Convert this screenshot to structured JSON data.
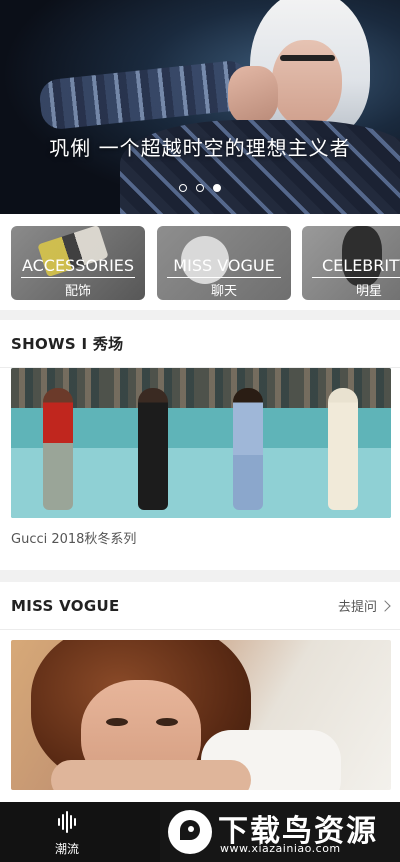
{
  "hero": {
    "title": "巩俐 一个超越时空的理想主义者",
    "slides": 3,
    "active_slide": 3
  },
  "categories": [
    {
      "en": "ACCESSORIES",
      "zh": "配饰"
    },
    {
      "en": "MISS VOGUE",
      "zh": "聊天"
    },
    {
      "en": "CELEBRITY",
      "zh": "明星"
    }
  ],
  "shows": {
    "title": "SHOWS I 秀场",
    "caption": "Gucci 2018秋冬系列"
  },
  "miss_vogue": {
    "title": "MISS VOGUE",
    "more_label": "去提问"
  },
  "tabbar": {
    "tab1_label": "潮流"
  },
  "watermark": {
    "title": "下载鸟资源",
    "url": "www.xiazainiao.com"
  },
  "colors": {
    "tabbar_bg": "#121212",
    "section_title": "#222222",
    "page_bg": "#f1f1f1"
  }
}
